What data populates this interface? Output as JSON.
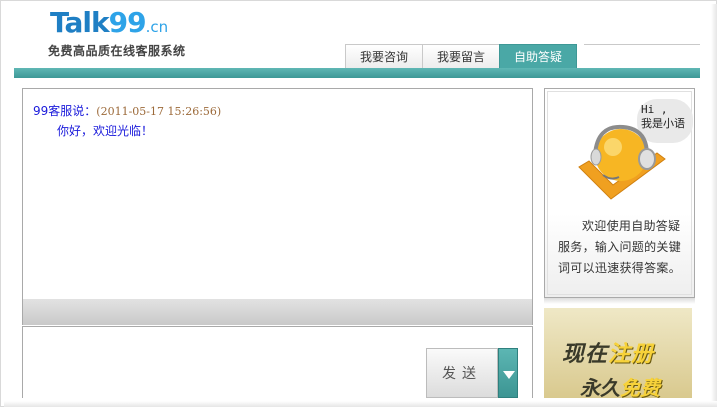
{
  "logo": {
    "main": "Talk",
    "numbers": "99",
    "suffix": ".cn"
  },
  "slogan": "免费高品质在线客服系统",
  "tabs": [
    {
      "label": "我要咨询",
      "active": false
    },
    {
      "label": "我要留言",
      "active": false
    },
    {
      "label": "自助答疑",
      "active": true
    }
  ],
  "chat": {
    "messages": [
      {
        "author": "99客服说：",
        "time": "(2011-05-17 15:26:56)",
        "text": "你好，欢迎光临！"
      }
    ]
  },
  "input": {
    "value": ""
  },
  "send_button": {
    "label": "发送"
  },
  "assistant_panel": {
    "bubble": "Hi ,\n我是小语",
    "description": "欢迎使用自助答疑服务，输入问题的关键词可以迅速获得答案。"
  },
  "ad": {
    "line1_prefix": "现在",
    "line1_highlight": "注册",
    "line2_prefix": "永久",
    "line2_highlight": "免费"
  },
  "colors": {
    "accent": "#4aa8a6",
    "author_blue": "#1a1adb",
    "time_brown": "#9c6a3a"
  }
}
